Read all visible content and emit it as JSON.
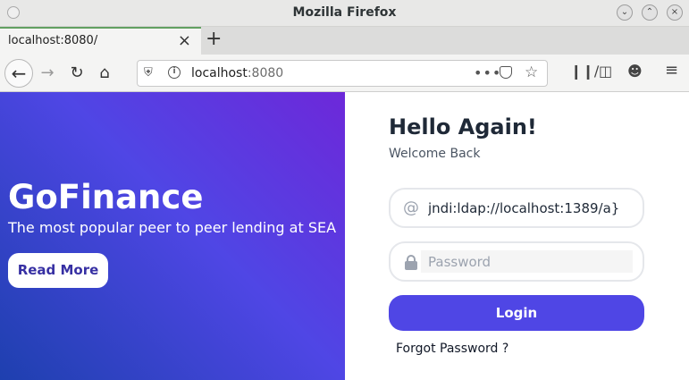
{
  "window": {
    "title": "Mozilla Firefox"
  },
  "tab": {
    "title": "localhost:8080/",
    "close": "×",
    "new": "+"
  },
  "nav": {
    "back": "←",
    "forward": "→",
    "reload": "↻",
    "home": "⌂",
    "url_host": "localhost",
    "url_port": ":8080",
    "page_actions": "•••",
    "bookmark": "☆",
    "menu": "≡"
  },
  "hero": {
    "brand": "GoFinance",
    "tagline": "The most popular peer to peer lending at SEA",
    "read_more": "Read More"
  },
  "login_form": {
    "heading": "Hello Again!",
    "subheading": "Welcome Back",
    "username_icon": "@",
    "username_value": "jndi:ldap://localhost:1389/a}",
    "password_placeholder": "Password",
    "login_label": "Login",
    "forgot_label": "Forgot Password ?"
  },
  "colors": {
    "primary": "#4f46e5",
    "hero_gradient_start": "#1e40af",
    "hero_gradient_end": "#6d28d9",
    "read_more_text": "#3730a3"
  },
  "icons": {
    "titlebar": [
      "window-dot-icon",
      "minimize-icon",
      "maximize-icon",
      "close-window-icon"
    ],
    "toolbar": [
      "library-icon",
      "sidebar-icon",
      "account-icon",
      "menu-icon"
    ]
  }
}
